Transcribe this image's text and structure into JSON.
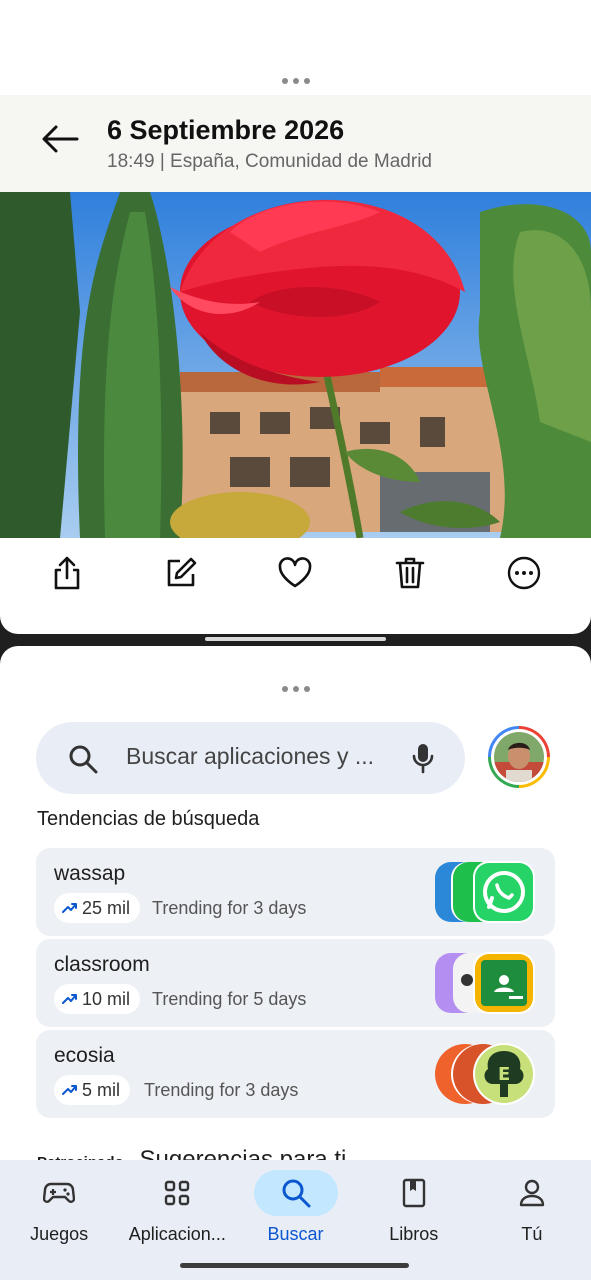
{
  "photo_viewer": {
    "date": "6 Septiembre 2026",
    "meta": "18:49 | España, Comunidad de Madrid",
    "actions": [
      "share-icon",
      "edit-icon",
      "heart-icon",
      "trash-icon",
      "more-icon"
    ]
  },
  "play_store": {
    "search_placeholder": "Buscar aplicaciones y ...",
    "trending_title": "Tendencias de búsqueda",
    "trends": [
      {
        "term": "wassap",
        "count": "25 mil",
        "sub": "Trending for 3 days"
      },
      {
        "term": "classroom",
        "count": "10 mil",
        "sub": "Trending for 5 days"
      },
      {
        "term": "ecosia",
        "count": "5 mil",
        "sub": "Trending for 3 days"
      }
    ],
    "partial_section": {
      "sponsored": "Patrocinado ·",
      "title": "Sugerencias para ti"
    },
    "nav": [
      {
        "label": "Juegos",
        "icon": "gamepad-icon"
      },
      {
        "label": "Aplicacion...",
        "icon": "apps-grid-icon"
      },
      {
        "label": "Buscar",
        "icon": "search-icon"
      },
      {
        "label": "Libros",
        "icon": "book-icon"
      },
      {
        "label": "Tú",
        "icon": "person-icon"
      }
    ],
    "active_nav": "Buscar"
  },
  "colors": {
    "accent": "#0b57d0",
    "active_pill": "#c2e7ff",
    "card_bg": "#edf0f5",
    "search_bg": "#e9eef6"
  }
}
